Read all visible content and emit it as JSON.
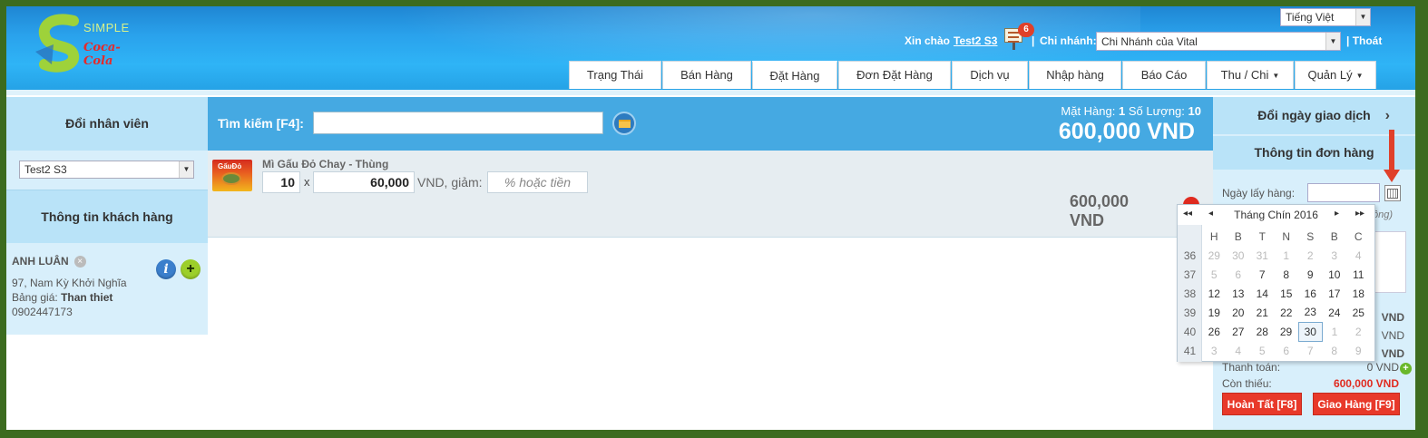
{
  "header": {
    "logo_text": "SIMPLE",
    "logo_brand": "Coca-Cola",
    "language": "Tiếng Việt",
    "greeting_prefix": "Xin chào",
    "user_name": "Test2 S3",
    "notification_count": "6",
    "separator": "|",
    "branch_label": "Chi nhánh:",
    "branch_value": "Chi Nhánh của Vital",
    "logout": "| Thoát"
  },
  "nav": {
    "items": [
      {
        "label": "Trạng Thái",
        "has_caret": false
      },
      {
        "label": "Bán Hàng",
        "has_caret": false
      },
      {
        "label": "Đặt Hàng",
        "has_caret": false,
        "active": true
      },
      {
        "label": "Đơn Đặt Hàng",
        "has_caret": false
      },
      {
        "label": "Dịch vụ",
        "has_caret": false
      },
      {
        "label": "Nhập hàng",
        "has_caret": false
      },
      {
        "label": "Báo Cáo",
        "has_caret": false
      },
      {
        "label": "Thu / Chi",
        "has_caret": true
      },
      {
        "label": "Quản Lý",
        "has_caret": true
      }
    ]
  },
  "left": {
    "change_staff": "Đổi nhân viên",
    "staff_value": "Test2 S3",
    "customer_info_title": "Thông tin khách hàng",
    "customer": {
      "name": "ANH LUÂN",
      "address": "97, Nam Kỳ Khởi Nghĩa",
      "price_list_label": "Bảng giá:",
      "price_list_value": "Than thiet",
      "phone": "0902447173"
    }
  },
  "search": {
    "label": "Tìm kiếm [F4]:",
    "value": "",
    "summary_items_label": "Mặt Hàng:",
    "summary_items_value": "1",
    "summary_qty_label": "Số Lượng:",
    "summary_qty_value": "10",
    "total": "600,000 VND"
  },
  "cart": {
    "items": [
      {
        "name": "Mì Gấu Đỏ Chay - Thùng",
        "thumb_text": "GấuĐỏ",
        "qty": "10",
        "times": "x",
        "price": "60,000",
        "unit_discount": "VND, giảm:",
        "discount_placeholder": "% hoặc tiền",
        "line_total_1": "600,000",
        "line_total_2": "VND"
      }
    ]
  },
  "right": {
    "change_date": "Đổi ngày giao dịch",
    "change_date_icon": "›",
    "order_info": "Thông tin đơn hàng",
    "pickup_label": "Ngày lấy hàng:",
    "pickup_value": "",
    "partial_text_1": "ông)",
    "partial_vnd_1": "VND",
    "partial_vnd_2": "VND",
    "partial_vnd_3": "VND",
    "payment_label": "Thanh toán:",
    "payment_value": "0 VND",
    "remaining_label": "Còn thiếu:",
    "remaining_value": "600,000 VND",
    "complete_button": "Hoàn Tất [F8]",
    "deliver_button": "Giao Hàng [F9]"
  },
  "datepicker": {
    "prev_year": "◂◂",
    "prev_month": "◂",
    "title": "Tháng Chín 2016",
    "next_month": "▸",
    "next_year": "▸▸",
    "day_headers": [
      "H",
      "B",
      "T",
      "N",
      "S",
      "B",
      "C"
    ],
    "weeks": [
      {
        "week": "36",
        "days": [
          {
            "d": "29",
            "o": true
          },
          {
            "d": "30",
            "o": true
          },
          {
            "d": "31",
            "o": true
          },
          {
            "d": "1",
            "o": true
          },
          {
            "d": "2",
            "o": true
          },
          {
            "d": "3",
            "o": true
          },
          {
            "d": "4",
            "o": true
          }
        ]
      },
      {
        "week": "37",
        "days": [
          {
            "d": "5",
            "o": true
          },
          {
            "d": "6",
            "o": true
          },
          {
            "d": "7"
          },
          {
            "d": "8"
          },
          {
            "d": "9"
          },
          {
            "d": "10"
          },
          {
            "d": "11"
          }
        ]
      },
      {
        "week": "38",
        "days": [
          {
            "d": "12"
          },
          {
            "d": "13"
          },
          {
            "d": "14"
          },
          {
            "d": "15"
          },
          {
            "d": "16"
          },
          {
            "d": "17"
          },
          {
            "d": "18"
          }
        ]
      },
      {
        "week": "39",
        "days": [
          {
            "d": "19"
          },
          {
            "d": "20"
          },
          {
            "d": "21"
          },
          {
            "d": "22"
          },
          {
            "d": "23"
          },
          {
            "d": "24"
          },
          {
            "d": "25"
          }
        ]
      },
      {
        "week": "40",
        "days": [
          {
            "d": "26"
          },
          {
            "d": "27"
          },
          {
            "d": "28"
          },
          {
            "d": "29"
          },
          {
            "d": "30",
            "today": true
          },
          {
            "d": "1",
            "o": true
          },
          {
            "d": "2",
            "o": true
          }
        ]
      },
      {
        "week": "41",
        "days": [
          {
            "d": "3",
            "o": true
          },
          {
            "d": "4",
            "o": true
          },
          {
            "d": "5",
            "o": true
          },
          {
            "d": "6",
            "o": true
          },
          {
            "d": "7",
            "o": true
          },
          {
            "d": "8",
            "o": true
          },
          {
            "d": "9",
            "o": true
          }
        ]
      }
    ]
  }
}
